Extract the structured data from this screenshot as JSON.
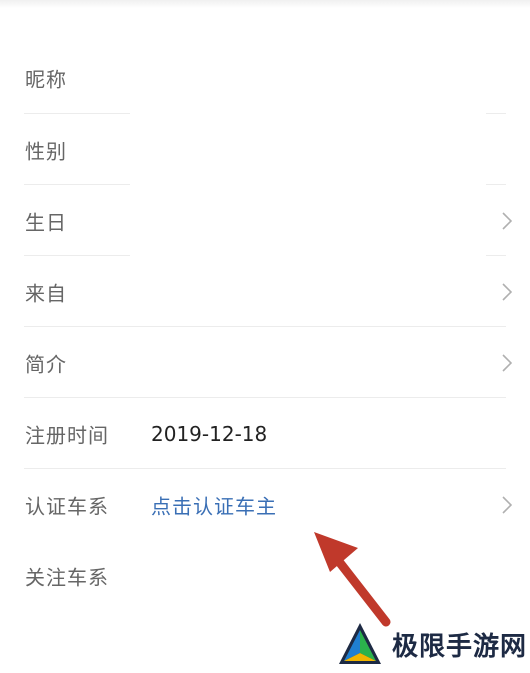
{
  "profile": {
    "rows": [
      {
        "label": "昵称",
        "value": "",
        "has_chevron": false
      },
      {
        "label": "性别",
        "value": "",
        "has_chevron": false
      },
      {
        "label": "生日",
        "value": "",
        "has_chevron": true
      },
      {
        "label": "来自",
        "value": "",
        "has_chevron": true
      },
      {
        "label": "简介",
        "value": "",
        "has_chevron": true
      },
      {
        "label": "注册时间",
        "value": "2019-12-18",
        "has_chevron": false
      },
      {
        "label": "认证车系",
        "value": "点击认证车主",
        "has_chevron": true
      },
      {
        "label": "关注车系",
        "value": "",
        "has_chevron": false
      }
    ]
  },
  "annotation": {
    "arrow_icon": "red-pointer-arrow-icon",
    "arrow_color": "#c0392b"
  },
  "watermark": {
    "text": "极限手游网",
    "logo_icon": "triangle-logo-icon",
    "logo_colors": [
      "#1f7fd1",
      "#2bb24c",
      "#f0b400"
    ]
  },
  "colors": {
    "label": "#666666",
    "value": "#222222",
    "link": "#3a6fb5",
    "divider": "#ececec"
  }
}
